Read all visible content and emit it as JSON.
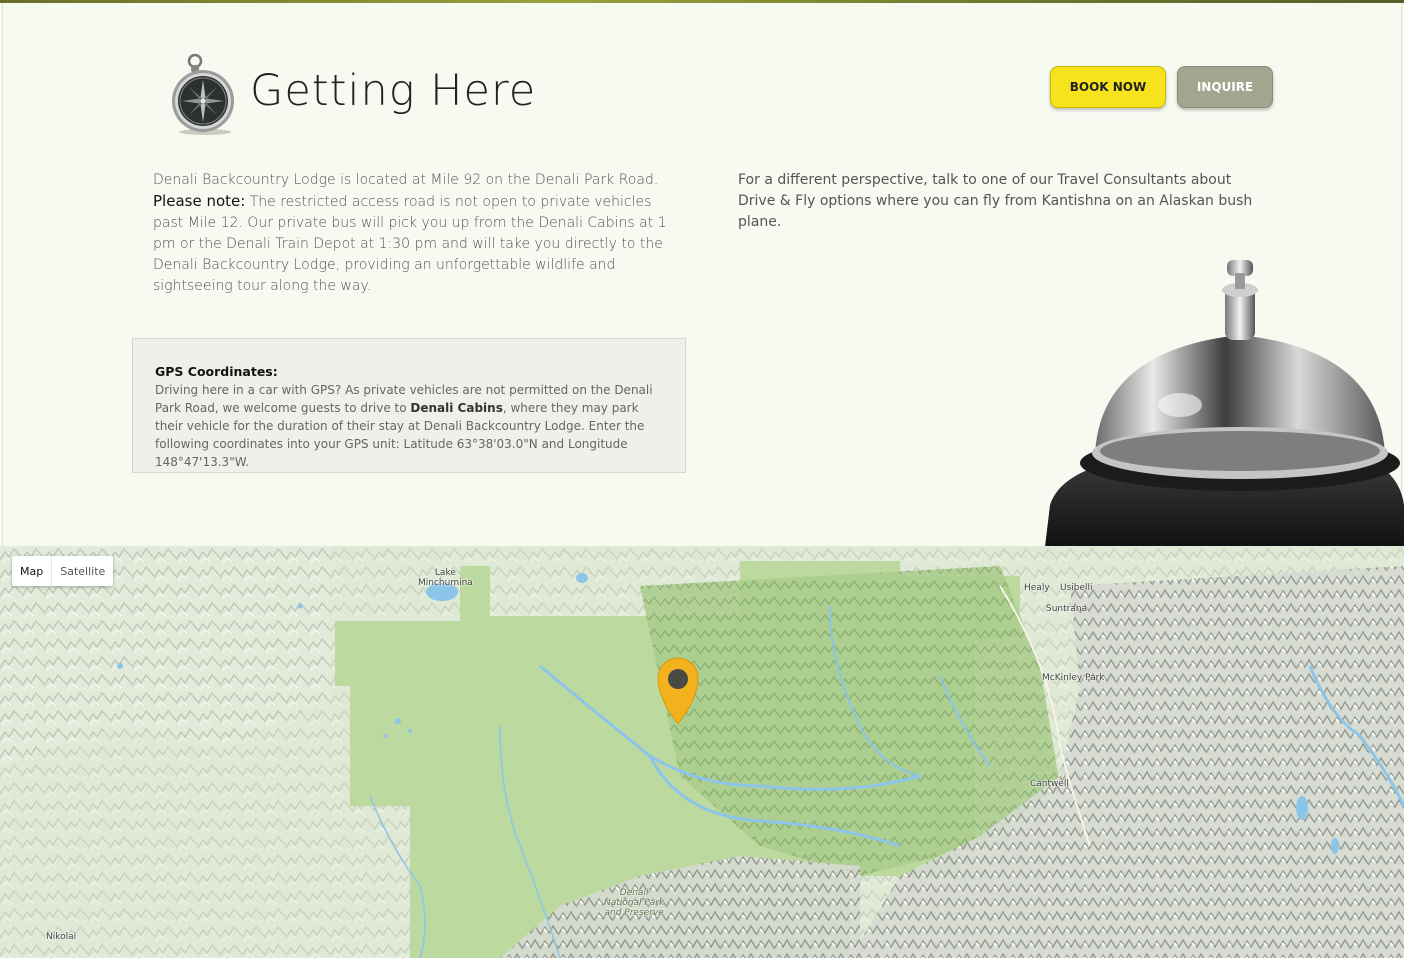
{
  "header": {
    "title": "Getting Here",
    "book_button": "BOOK NOW",
    "inquire_button": "INQUIRE",
    "icon": "compass-icon"
  },
  "intro": {
    "line1": "Denali Backcountry Lodge is located at Mile 92 on the Denali Park Road.",
    "note_label": "Please note:",
    "note_text": "The restricted access road is not open to private vehicles past Mile 12. Our private bus will pick you up from the Denali Cabins at 1 pm or the Denali Train Depot at 1:30 pm and will take you directly to the Denali Backcountry Lodge, providing an unforgettable wildlife and sightseeing tour along the way."
  },
  "alt_transport": "For a different perspective, talk to one of our Travel Consultants about Drive & Fly options where you can fly from Kantishna on an Alaskan bush plane.",
  "gps": {
    "heading": "GPS Coordinates:",
    "text_before": "Driving here in a car with GPS?  As private vehicles are not permitted on the Denali Park Road, we welcome guests to drive to ",
    "bold_place": "Denali Cabins",
    "text_after": ", where they may park their vehicle for the duration of their stay at Denali Backcountry Lodge. Enter the following coordinates into your GPS unit: Latitude 63°38'03.0\"N and Longitude 148°47'13.3\"W."
  },
  "map": {
    "type_buttons": [
      "Map",
      "Satellite"
    ],
    "labels": {
      "lake_line1": "Lake",
      "lake_line2": "Minchumina",
      "healy": "Healy",
      "usibelli": "Usibelli",
      "suntrana": "Suntrana",
      "mckinley_park": "McKinley Park",
      "cantwell": "Cantwell",
      "park_line1": "Denali",
      "park_line2": "National Park",
      "park_line3": "and Preserve",
      "nikolai": "Nikolai"
    },
    "marker_color": "#f3b11e",
    "marker_icon": "map-pin-icon"
  },
  "colors": {
    "accent_yellow": "#f7e31c",
    "inquire_gray": "#a4a58e",
    "park_green": "#b9d89a",
    "terrain": "#d8e6c8"
  }
}
